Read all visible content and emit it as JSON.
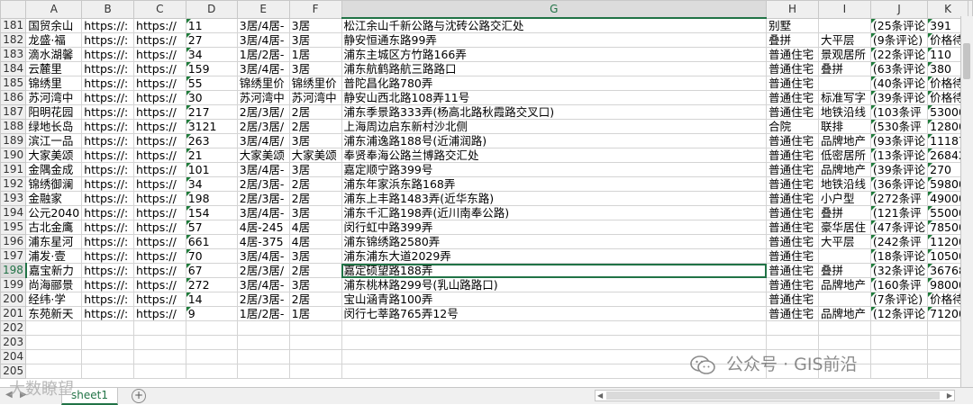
{
  "columns": [
    "A",
    "B",
    "C",
    "D",
    "E",
    "F",
    "G",
    "H",
    "I",
    "J",
    "K"
  ],
  "selected_column": "G",
  "selected_row": "198",
  "rows": [
    {
      "n": "181",
      "c": [
        "国贸余山",
        "https://:",
        "https://",
        "11",
        "3居/4居-",
        "3居",
        "松江余山千新公路与沈砖公路交汇处",
        "别墅",
        "",
        "(25条评论",
        "391"
      ]
    },
    {
      "n": "182",
      "c": [
        "龙盛·福",
        "https://:",
        "https://",
        "27",
        "3居/4居-",
        "3居",
        "静安恒通东路99弄",
        "叠拼",
        "大平层",
        "(9条评论)",
        "价格待"
      ]
    },
    {
      "n": "183",
      "c": [
        "滴水湖馨",
        "https://:",
        "https://",
        "34",
        "1居/2居-",
        "1居",
        "浦东主城区方竹路166弄",
        "普通住宅",
        "景观居所",
        "(22条评论",
        "110"
      ]
    },
    {
      "n": "184",
      "c": [
        "云麓里",
        "https://:",
        "https://",
        "159",
        "3居/4居-",
        "3居",
        "浦东航鹤路航三路路口",
        "普通住宅",
        "叠拼",
        "(63条评论",
        "380"
      ]
    },
    {
      "n": "185",
      "c": [
        "锦绣里",
        "https://:",
        "https://",
        "55",
        "锦绣里价",
        "锦绣里价",
        "普陀昌化路780弄",
        "普通住宅",
        "",
        "(40条评论",
        "价格待"
      ]
    },
    {
      "n": "186",
      "c": [
        "苏河湾中",
        "https://:",
        "https://",
        "30",
        "苏河湾中",
        "苏河湾中",
        "静安山西北路108弄11号",
        "普通住宅",
        "标准写字",
        "(39条评论",
        "价格待"
      ]
    },
    {
      "n": "187",
      "c": [
        "阳明花园",
        "https://:",
        "https://",
        "217",
        "2居/3居/",
        "2居",
        "浦东季景路333弄(杨高北路秋霞路交叉口)",
        "普通住宅",
        "地铁沿线",
        "(103条评",
        "53000"
      ]
    },
    {
      "n": "188",
      "c": [
        "绿地长岛",
        "https://:",
        "https://",
        "3121",
        "2居/3居/",
        "2居",
        "上海周边启东新村沙北侧",
        "合院",
        "联排",
        "(530条评",
        "12800"
      ]
    },
    {
      "n": "189",
      "c": [
        "滨江一品",
        "https://:",
        "https://",
        "263",
        "3居/4居/",
        "3居",
        "浦东浦逸路188号(近浦润路)",
        "普通住宅",
        "品牌地产",
        "(93条评论",
        "11187"
      ]
    },
    {
      "n": "190",
      "c": [
        "大家美颂",
        "https://:",
        "https://",
        "21",
        "大家美颂",
        "大家美颂",
        "奉贤奉海公路兰博路交汇处",
        "普通住宅",
        "低密居所",
        "(13条评论",
        "26842"
      ]
    },
    {
      "n": "191",
      "c": [
        "金隅金成",
        "https://:",
        "https://",
        "101",
        "3居/4居-",
        "3居",
        "嘉定顺宁路399号",
        "普通住宅",
        "品牌地产",
        "(39条评论",
        "270"
      ]
    },
    {
      "n": "192",
      "c": [
        "锦绣御澜",
        "https://:",
        "https://",
        "34",
        "2居/3居-",
        "2居",
        "浦东年家浜东路168弄",
        "普通住宅",
        "地铁沿线",
        "(36条评论",
        "59800"
      ]
    },
    {
      "n": "193",
      "c": [
        "金融家",
        "https://:",
        "https://",
        "198",
        "2居/3居-",
        "2居",
        "浦东上丰路1483弄(近华东路)",
        "普通住宅",
        "小户型",
        "(272条评",
        "49000"
      ]
    },
    {
      "n": "194",
      "c": [
        "公元2040",
        "https://:",
        "https://",
        "154",
        "3居/4居-",
        "3居",
        "浦东千汇路198弄(近川南奉公路)",
        "普通住宅",
        "叠拼",
        "(121条评",
        "55000"
      ]
    },
    {
      "n": "195",
      "c": [
        "古北金鹰",
        "https://:",
        "https://",
        "57",
        "4居-245",
        "4居",
        "闵行虹中路399弄",
        "普通住宅",
        "豪华居住",
        "(47条评论",
        "78500"
      ]
    },
    {
      "n": "196",
      "c": [
        "浦东星河",
        "https://:",
        "https://",
        "661",
        "4居-375",
        "4居",
        "浦东锦绣路2580弄",
        "普通住宅",
        "大平层",
        "(242条评",
        "11200"
      ]
    },
    {
      "n": "197",
      "c": [
        "浦发·壹",
        "https://:",
        "https://",
        "70",
        "3居/4居-",
        "3居",
        "浦东浦东大道2029弄",
        "普通住宅",
        "",
        "(18条评论",
        "10500"
      ]
    },
    {
      "n": "198",
      "c": [
        "嘉宝新力",
        "https://:",
        "https://",
        "67",
        "2居/3居/",
        "2居",
        "嘉定硕望路188弄",
        "普通住宅",
        "叠拼",
        "(32条评论",
        "36768"
      ]
    },
    {
      "n": "199",
      "c": [
        "尚海郦景",
        "https://:",
        "https://",
        "272",
        "3居/4居-",
        "3居",
        "浦东桃林路299号(乳山路路口)",
        "普通住宅",
        "品牌地产",
        "(160条评",
        "98000"
      ]
    },
    {
      "n": "200",
      "c": [
        "经纬·学",
        "https://:",
        "https://",
        "14",
        "2居/3居-",
        "2居",
        "宝山涵青路100弄",
        "普通住宅",
        "",
        "(7条评论)",
        "价格待"
      ]
    },
    {
      "n": "201",
      "c": [
        "东苑新天",
        "https://:",
        "https://",
        "9",
        "1居/2居-",
        "1居",
        "闵行七莘路765弄12号",
        "普通住宅",
        "品牌地产",
        "(12条评论",
        "71200"
      ]
    },
    {
      "n": "202",
      "c": [
        "",
        "",
        "",
        "",
        "",
        "",
        "",
        "",
        "",
        "",
        ""
      ]
    },
    {
      "n": "203",
      "c": [
        "",
        "",
        "",
        "",
        "",
        "",
        "",
        "",
        "",
        "",
        ""
      ]
    },
    {
      "n": "204",
      "c": [
        "",
        "",
        "",
        "",
        "",
        "",
        "",
        "",
        "",
        "",
        ""
      ]
    },
    {
      "n": "205",
      "c": [
        "",
        "",
        "",
        "",
        "",
        "",
        "",
        "",
        "",
        "",
        ""
      ]
    }
  ],
  "sheet_tab": "sheet1",
  "watermark_left": "大数瞭望",
  "watermark_right": "公众号 · GIS前沿",
  "colors": {
    "accent": "#217346",
    "flag": "#1e7b3a"
  }
}
